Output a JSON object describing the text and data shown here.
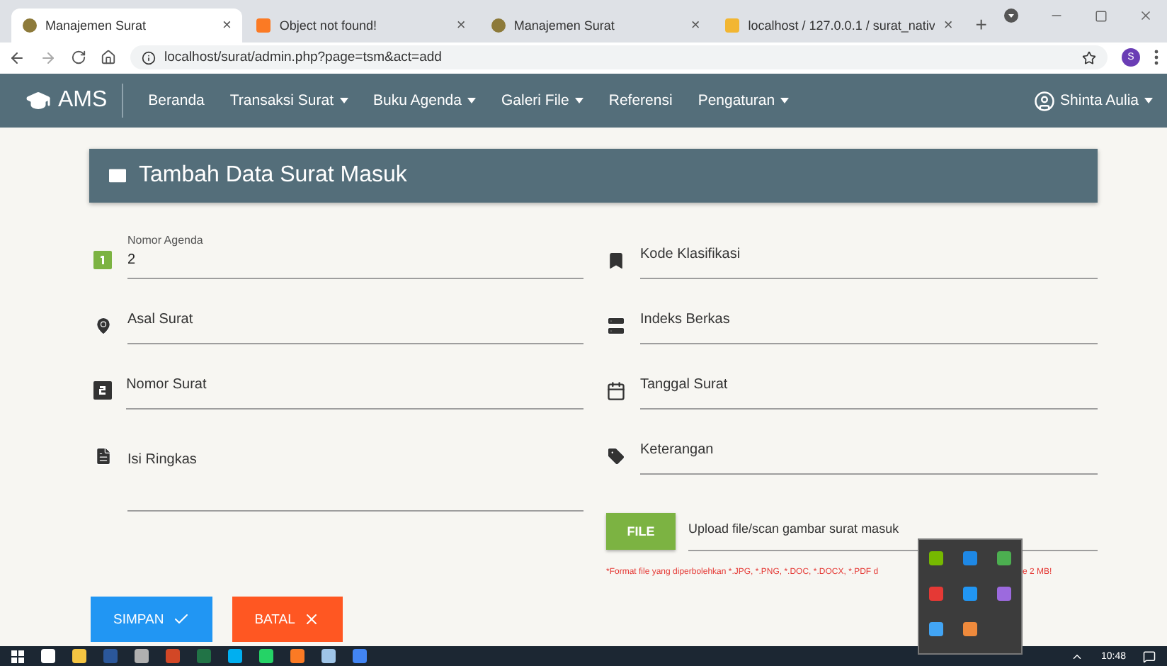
{
  "browser": {
    "tabs": [
      {
        "title": "Manajemen Surat",
        "selected": true,
        "close": "×",
        "kind": "seal"
      },
      {
        "title": "Object not found!",
        "selected": false,
        "close": "×",
        "kind": "xampp"
      },
      {
        "title": "Manajemen Surat",
        "selected": false,
        "close": "×",
        "kind": "seal"
      },
      {
        "title": "localhost / 127.0.0.1 / surat_nativ",
        "selected": false,
        "close": "×",
        "kind": "pma"
      }
    ],
    "new_tab": "+",
    "url": "localhost/surat/admin.php?page=tsm&act=add",
    "profile": "S"
  },
  "navbar": {
    "brand": "AMS",
    "items": [
      {
        "label": "Beranda",
        "dropdown": false
      },
      {
        "label": "Transaksi Surat",
        "dropdown": true
      },
      {
        "label": "Buku Agenda",
        "dropdown": true
      },
      {
        "label": "Galeri File",
        "dropdown": true
      },
      {
        "label": "Referensi",
        "dropdown": false
      },
      {
        "label": "Pengaturan",
        "dropdown": true
      }
    ],
    "user": "Shinta Aulia"
  },
  "form": {
    "title": "Tambah Data Surat Masuk",
    "left": [
      {
        "label": "Nomor Agenda",
        "value": "2"
      },
      {
        "placeholder": "Asal Surat"
      },
      {
        "placeholder": "Nomor Surat"
      },
      {
        "placeholder": "Isi Ringkas",
        "kind": "textarea"
      }
    ],
    "right": [
      {
        "placeholder": "Kode Klasifikasi"
      },
      {
        "placeholder": "Indeks Berkas"
      },
      {
        "placeholder": "Tanggal Surat"
      },
      {
        "placeholder": "Keterangan"
      }
    ],
    "file": {
      "button": "FILE",
      "placeholder": "Upload file/scan gambar surat masuk",
      "note_start": "*Format file yang diperbolehkan *.JPG, *.PNG, *.DOC, *.DOCX, *.PDF d",
      "note_end": "e 2 MB!"
    },
    "buttons": [
      {
        "label": "SIMPAN",
        "kind": "save"
      },
      {
        "label": "BATAL",
        "kind": "cancel"
      }
    ]
  },
  "tray_popup": [
    {
      "color": "#76b900"
    },
    {
      "color": "#1e88e5"
    },
    {
      "color": "#4caf50"
    },
    {
      "color": "#e53935"
    },
    {
      "color": "#2196f3"
    },
    {
      "color": "#9c6ade"
    },
    {
      "color": "#42a5f5"
    },
    {
      "color": "#ef8a3c"
    }
  ],
  "taskbar": {
    "apps": [
      {
        "color": "#ffffff"
      },
      {
        "color": "#f5c542"
      },
      {
        "color": "#2b579a"
      },
      {
        "color": "#b0b0b0"
      },
      {
        "color": "#d24726"
      },
      {
        "color": "#217346"
      },
      {
        "color": "#00aff0"
      },
      {
        "color": "#25d366"
      },
      {
        "color": "#fb7a24"
      },
      {
        "color": "#9fc5e8"
      },
      {
        "color": "#4285f4"
      }
    ],
    "time": "10:48"
  }
}
